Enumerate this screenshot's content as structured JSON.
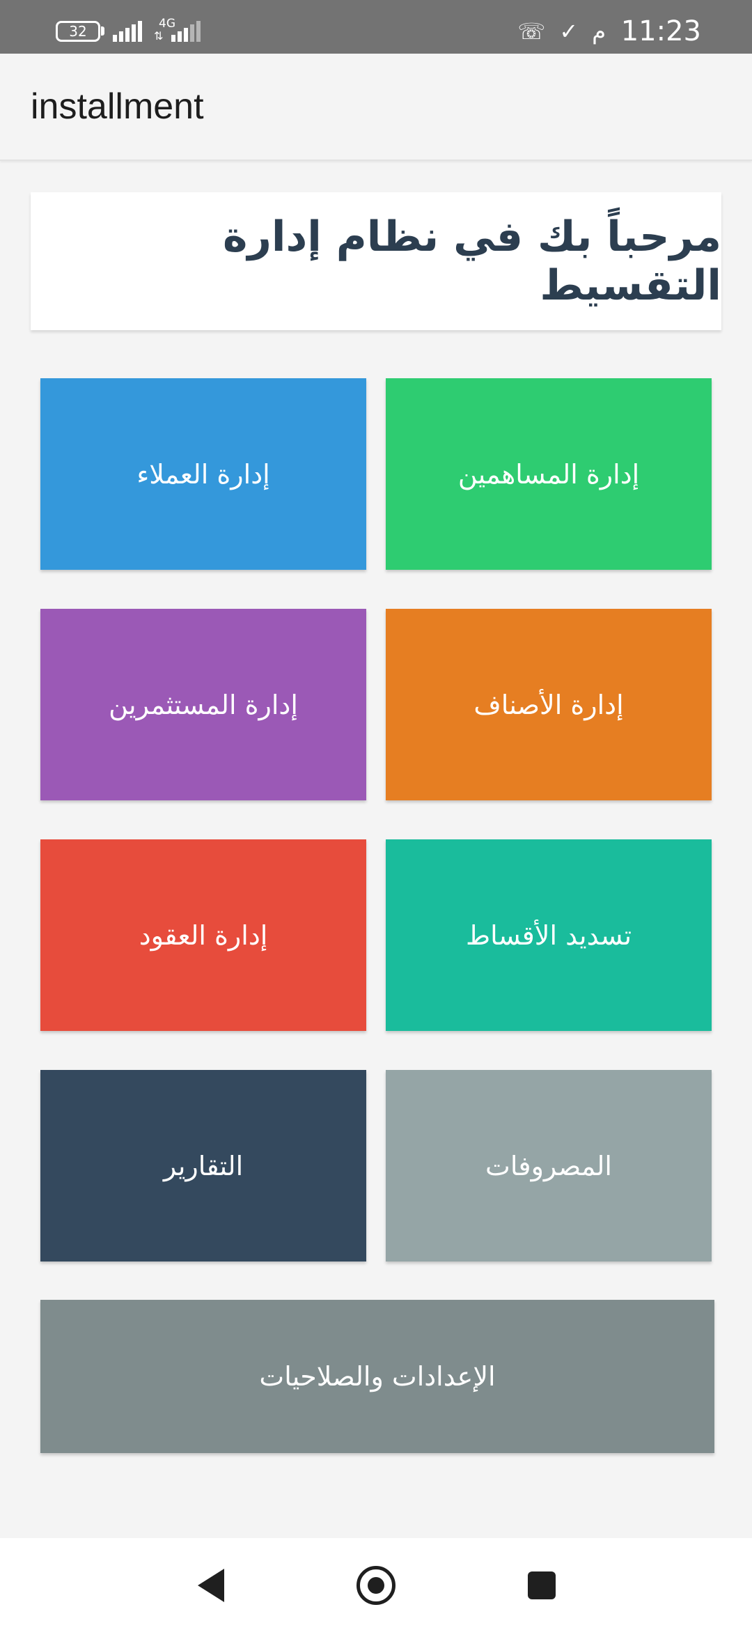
{
  "status_bar": {
    "battery": "32",
    "network": "4G",
    "network_arrows": "⇅",
    "time": "11:23",
    "period": "م",
    "check_icon": "✓",
    "call_icon": "☏"
  },
  "app_bar": {
    "title": "installment"
  },
  "welcome": {
    "text": "مرحباً بك في نظام إدارة التقسيط"
  },
  "menu": {
    "shareholders": {
      "label": "إدارة المساهمين",
      "color": "#2ecc71"
    },
    "customers": {
      "label": "إدارة العملاء",
      "color": "#3498db"
    },
    "categories": {
      "label": "إدارة الأصناف",
      "color": "#e67e22"
    },
    "investors": {
      "label": "إدارة المستثمرين",
      "color": "#9b59b6"
    },
    "installments": {
      "label": "تسديد الأقساط",
      "color": "#1abc9c"
    },
    "contracts": {
      "label": "إدارة العقود",
      "color": "#e74c3c"
    },
    "expenses": {
      "label": "المصروفات",
      "color": "#95a5a6"
    },
    "reports": {
      "label": "التقارير",
      "color": "#34495e"
    },
    "settings": {
      "label": "الإعدادات والصلاحيات",
      "color": "#7f8c8d"
    }
  },
  "nav": {
    "back_icon": "back-triangle-icon",
    "home_icon": "home-circle-icon",
    "recents_icon": "recents-square-icon"
  }
}
